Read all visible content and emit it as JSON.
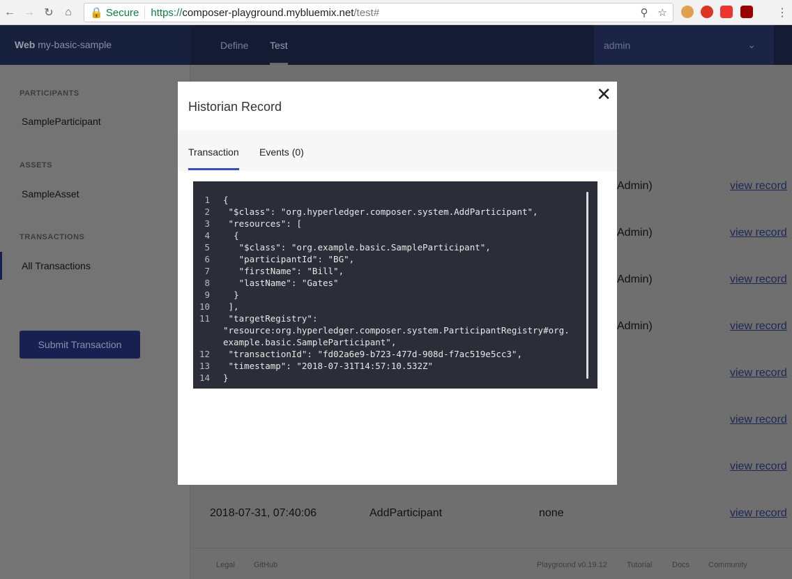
{
  "browser": {
    "secure_label": "Secure",
    "url_scheme": "https://",
    "url_host": "composer-playground.mybluemix.net",
    "url_path": "/test#"
  },
  "header": {
    "brand_bold": "Web",
    "brand_name": "my-basic-sample",
    "tabs": [
      "Define",
      "Test"
    ],
    "user": "admin"
  },
  "sidebar": {
    "participants_heading": "PARTICIPANTS",
    "participant": "SampleParticipant",
    "assets_heading": "ASSETS",
    "asset": "SampleAsset",
    "transactions_heading": "TRANSACTIONS",
    "all_transactions": "All Transactions",
    "submit": "Submit Transaction"
  },
  "rows": [
    {
      "participant": "Admin)",
      "link": "view record"
    },
    {
      "participant": "Admin)",
      "link": "view record"
    },
    {
      "participant": "Admin)",
      "link": "view record"
    },
    {
      "participant": "Admin)",
      "link": "view record"
    },
    {
      "participant": "",
      "link": "view record"
    },
    {
      "participant": "",
      "link": "view record"
    },
    {
      "participant": "",
      "link": "view record"
    },
    {
      "date": "2018-07-31, 07:40:06",
      "type": "AddParticipant",
      "participant": "none",
      "link": "view record"
    }
  ],
  "footer": {
    "legal": "Legal",
    "github": "GitHub",
    "version": "Playground v0.19.12",
    "tutorial": "Tutorial",
    "docs": "Docs",
    "community": "Community"
  },
  "modal": {
    "title": "Historian Record",
    "tabs": [
      "Transaction",
      "Events (0)"
    ],
    "code": [
      {
        "n": "1",
        "t": "{"
      },
      {
        "n": "2",
        "t": " \"$class\": \"org.hyperledger.composer.system.AddParticipant\","
      },
      {
        "n": "3",
        "t": " \"resources\": ["
      },
      {
        "n": "4",
        "t": "  {"
      },
      {
        "n": "5",
        "t": "   \"$class\": \"org.example.basic.SampleParticipant\","
      },
      {
        "n": "6",
        "t": "   \"participantId\": \"BG\","
      },
      {
        "n": "7",
        "t": "   \"firstName\": \"Bill\","
      },
      {
        "n": "8",
        "t": "   \"lastName\": \"Gates\""
      },
      {
        "n": "9",
        "t": "  }"
      },
      {
        "n": "10",
        "t": " ],"
      },
      {
        "n": "11",
        "t": " \"targetRegistry\":\n\"resource:org.hyperledger.composer.system.ParticipantRegistry#org.example.basic.SampleParticipant\","
      },
      {
        "n": "12",
        "t": " \"transactionId\": \"fd02a6e9-b723-477d-908d-f7ac519e5cc3\","
      },
      {
        "n": "13",
        "t": " \"timestamp\": \"2018-07-31T14:57:10.532Z\""
      },
      {
        "n": "14",
        "t": "}"
      }
    ]
  }
}
